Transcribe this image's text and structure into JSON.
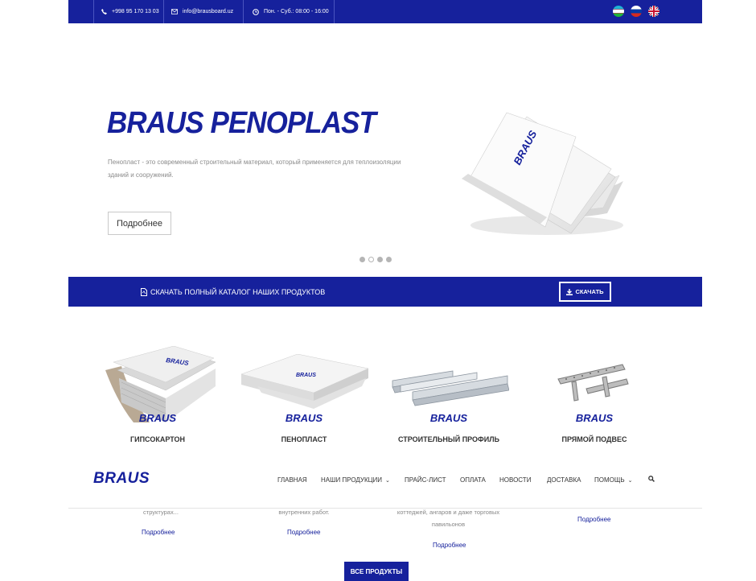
{
  "topbar": {
    "phone": "+998 95 170 13 03",
    "email": "info@brausboard.uz",
    "hours": "Пон. - Суб.: 08:00 - 16:00",
    "flags": [
      "uz-flag",
      "ru-flag",
      "gb-flag"
    ]
  },
  "hero": {
    "title": "BRAUS PENOPLAST",
    "description": "Пенопласт - это современный строительный материал, который применяется для теплоизоляции зданий и сооружений.",
    "button": "Подробнее",
    "slides": 4,
    "active_slide": 1,
    "image_brand": "BRAUS"
  },
  "catalog": {
    "text": "СКАЧАТЬ ПОЛНЫЙ КАТАЛОГ НАШИХ ПРОДУКТОВ",
    "button": "СКАЧАТЬ"
  },
  "products": [
    {
      "name": "ГИПСОКАРТОН",
      "brand": "BRAUS"
    },
    {
      "name": "ПЕНОПЛАСТ",
      "brand": "BRAUS"
    },
    {
      "name": "СТРОИТЕЛЬНЫЙ ПРОФИЛЬ",
      "brand": "BRAUS"
    },
    {
      "name": "ПРЯМОЙ ПОДВЕС",
      "brand": "BRAUS"
    }
  ],
  "nav": {
    "logo": "BRAUS",
    "items": [
      "ГЛАВНАЯ",
      "НАШИ ПРОДУКЦИИ",
      "ПРАЙС-ЛИСТ",
      "ОПЛАТА",
      "НОВОСТИ",
      "ДОСТАВКА",
      "ПОМОЩЬ"
    ]
  },
  "below": {
    "texts": [
      "структурах...",
      "внутренних работ.",
      "коттеджей, ангаров и даже торговых павильонов"
    ],
    "more": "Подробнее",
    "all_button": "ВСЕ ПРОДУКТЫ"
  },
  "colors": {
    "brand_blue": "#16219c"
  }
}
